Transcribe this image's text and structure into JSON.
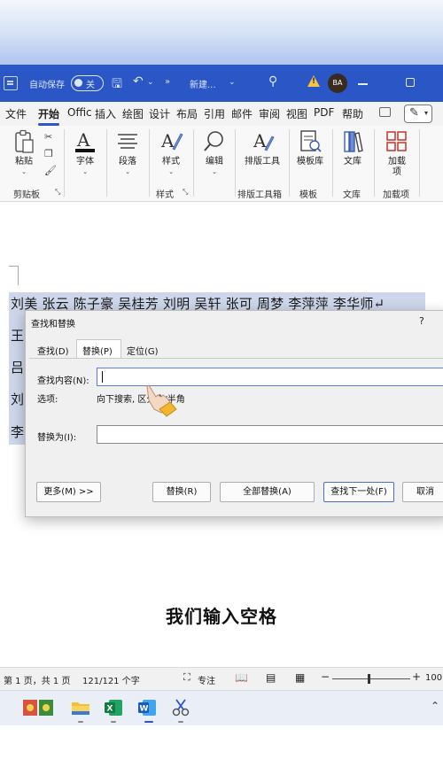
{
  "titlebar": {
    "autosave_label": "自动保存",
    "autosave_state": "关",
    "doc_name": "新建...",
    "avatar_initials": "BA"
  },
  "ribbon_tabs": [
    "文件",
    "开始",
    "Offic",
    "插入",
    "绘图",
    "设计",
    "布局",
    "引用",
    "邮件",
    "审阅",
    "视图",
    "PDF",
    "帮助"
  ],
  "ribbon": {
    "paste": "粘贴",
    "font": "字体",
    "paragraph": "段落",
    "styles": "样式",
    "editing": "编辑",
    "typesetting": "排版工具",
    "templates": "模板库",
    "library": "文库",
    "addins": "加载项",
    "groups": {
      "clipboard": "剪贴板",
      "styles": "样式",
      "typesetting": "排版工具箱",
      "templates": "模板",
      "library": "文库",
      "addins": "加载项"
    }
  },
  "document": {
    "line1": "刘美 张云 陈子豪 吴桂芳 刘明 吴轩 张可 周梦 李萍萍 李华师↵",
    "line_starts": [
      "王",
      "吕",
      "刘",
      "李"
    ]
  },
  "dialog": {
    "title": "查找和替换",
    "help": "?",
    "tabs": [
      "查找(D)",
      "替换(P)",
      "定位(G)"
    ],
    "find_label": "查找内容(N):",
    "find_value": "",
    "options_label": "选项:",
    "options_value": "向下搜索, 区分全/半角",
    "replace_label": "替换为(I):",
    "replace_value": "",
    "buttons": {
      "more": "更多(M) >>",
      "replace": "替换(R)",
      "replace_all": "全部替换(A)",
      "find_next": "查找下一处(F)",
      "cancel": "取消"
    }
  },
  "subtitle": "我们输入空格",
  "statusbar": {
    "page": "第 1 页，共 1 页",
    "words": "121/121 个字",
    "focus": "专注",
    "zoom": "100"
  },
  "colors": {
    "titlebar": "#2b56c5",
    "selection": "#cdd6ea",
    "find_next_border": "#4b6fcb"
  }
}
